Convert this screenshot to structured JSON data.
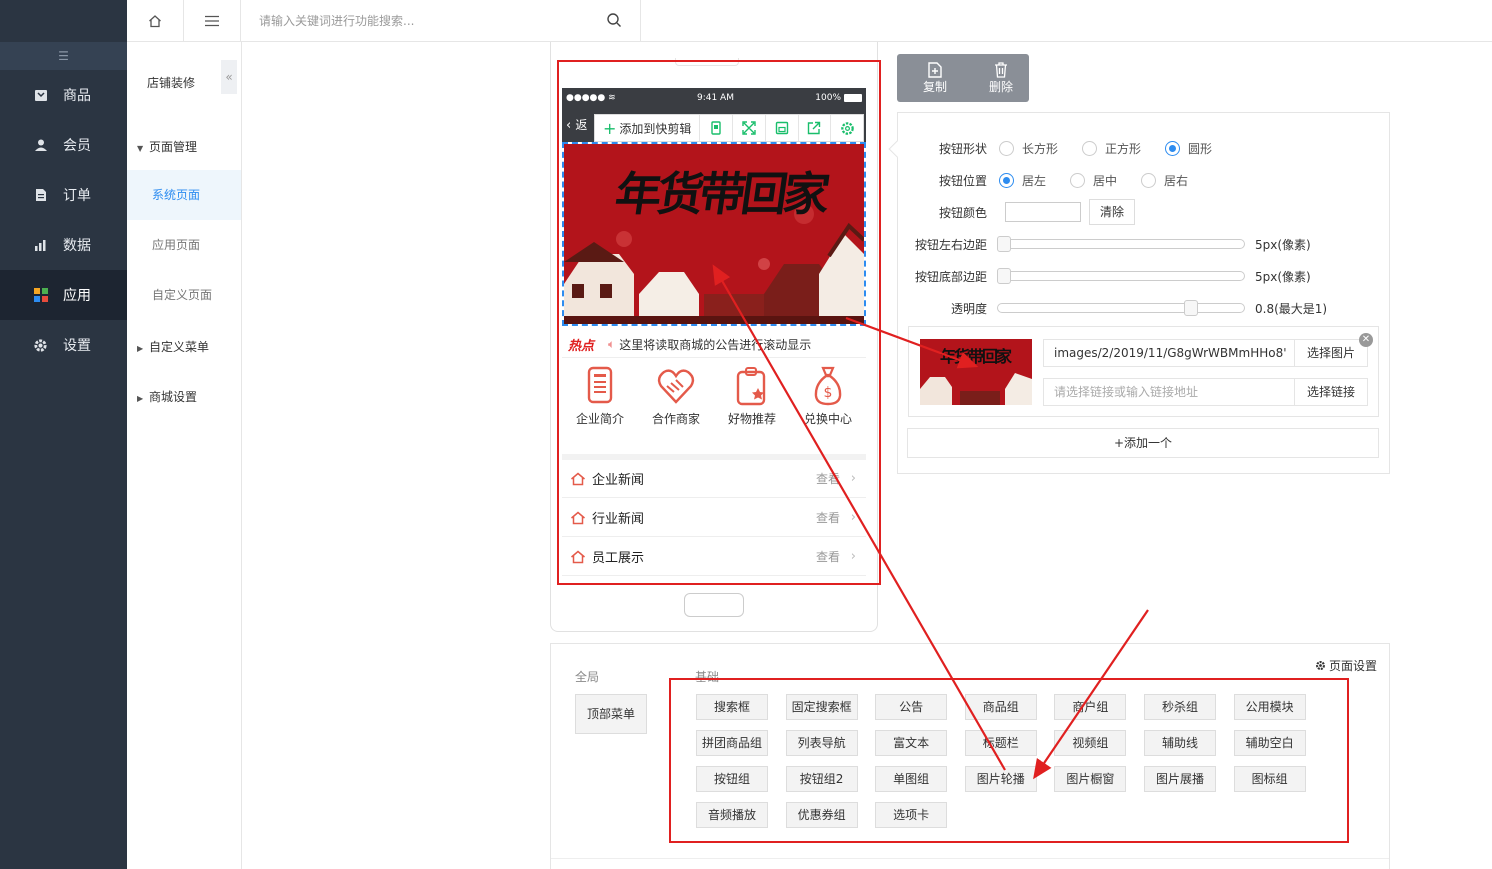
{
  "nav": {
    "items": [
      {
        "label": "商品",
        "icon": "goods-icon"
      },
      {
        "label": "会员",
        "icon": "user-icon"
      },
      {
        "label": "订单",
        "icon": "order-icon"
      },
      {
        "label": "数据",
        "icon": "chart-icon"
      },
      {
        "label": "应用",
        "icon": "apps-icon",
        "active": true
      },
      {
        "label": "设置",
        "icon": "gear-icon"
      }
    ]
  },
  "sub": {
    "title": "店铺装修",
    "toggle": "«",
    "group_page": "页面管理",
    "links": [
      "系统页面",
      "应用页面",
      "自定义页面"
    ],
    "group_menu": "自定义菜单",
    "group_shop": "商城设置"
  },
  "topbar": {
    "search_placeholder": "请输入关键词进行功能搜索..."
  },
  "phone": {
    "time": "9:41 AM",
    "battery": "100%",
    "back": "返",
    "quick_add": "添加到快剪辑",
    "banner_text": "年货带回家",
    "notice_hot": "热点",
    "notice_text": "这里将读取商城的公告进行滚动显示",
    "icons": [
      "企业简介",
      "合作商家",
      "好物推荐",
      "兑换中心"
    ],
    "news": [
      "企业新闻",
      "行业新闻",
      "员工展示"
    ],
    "news_more": "查看"
  },
  "actions": {
    "copy": "复制",
    "delete": "删除"
  },
  "settings": {
    "shape_label": "按钮形状",
    "shape_options": [
      "长方形",
      "正方形",
      "圆形"
    ],
    "shape_selected": 2,
    "position_label": "按钮位置",
    "position_options": [
      "居左",
      "居中",
      "居右"
    ],
    "position_selected": 0,
    "color_label": "按钮颜色",
    "clear": "清除",
    "lr_margin_label": "按钮左右边距",
    "lr_margin_value": "5px(像素)",
    "bottom_margin_label": "按钮底部边距",
    "bottom_margin_value": "5px(像素)",
    "opacity_label": "透明度",
    "opacity_value": "0.8(最大是1)",
    "opacity_fraction": 0.8,
    "image_path": "images/2/2019/11/G8gWrWBMmHHo8'",
    "choose_image": "选择图片",
    "link_placeholder": "请选择链接或输入链接地址",
    "choose_link": "选择链接",
    "add_one": "添加一个"
  },
  "components": {
    "global_title": "全局",
    "basic_title": "基础",
    "page_settings": "页面设置",
    "top_menu": "顶部菜单",
    "buttons": [
      "搜索框",
      "固定搜索框",
      "公告",
      "商品组",
      "商户组",
      "秒杀组",
      "公用模块",
      "拼团商品组",
      "列表导航",
      "富文本",
      "标题栏",
      "视频组",
      "辅助线",
      "辅助空白",
      "按钮组",
      "按钮组2",
      "单图组",
      "图片轮播",
      "图片橱窗",
      "图片展播",
      "图标组",
      "音频播放",
      "优惠券组",
      "选项卡"
    ]
  },
  "colors": {
    "sidebar": "#2b3542",
    "accent": "#2d8cf0",
    "annotation_red": "#e02020"
  }
}
